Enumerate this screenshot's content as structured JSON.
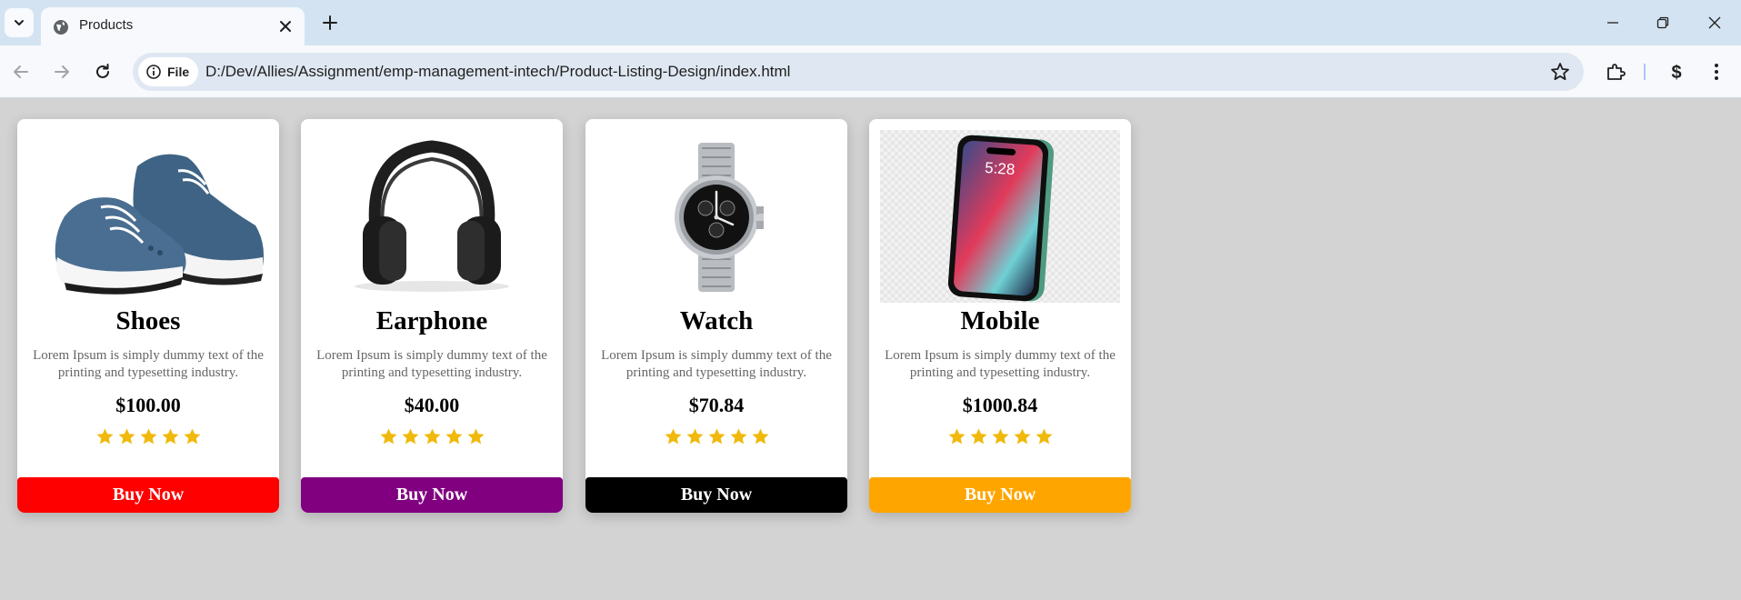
{
  "browser": {
    "tab_title": "Products",
    "file_chip_label": "File",
    "url": "D:/Dev/Allies/Assignment/emp-management-intech/Product-Listing-Design/index.html"
  },
  "products": [
    {
      "name": "Shoes",
      "description": "Lorem Ipsum is simply dummy text of the printing and typesetting industry.",
      "price": "$100.00",
      "rating": 5,
      "button_label": "Buy Now",
      "button_color": "#ff0000",
      "image": "shoes-image"
    },
    {
      "name": "Earphone",
      "description": "Lorem Ipsum is simply dummy text of the printing and typesetting industry.",
      "price": "$40.00",
      "rating": 5,
      "button_label": "Buy Now",
      "button_color": "#800080",
      "image": "headphones-image"
    },
    {
      "name": "Watch",
      "description": "Lorem Ipsum is simply dummy text of the printing and typesetting industry.",
      "price": "$70.84",
      "rating": 5,
      "button_label": "Buy Now",
      "button_color": "#000000",
      "image": "watch-image"
    },
    {
      "name": "Mobile",
      "description": "Lorem Ipsum is simply dummy text of the printing and typesetting industry.",
      "price": "$1000.84",
      "rating": 5,
      "button_label": "Buy Now",
      "button_color": "#ffa500",
      "image": "phone-image"
    }
  ],
  "colors": {
    "page_background": "#d3d3d3",
    "star": "#f0b90b",
    "tabstrip": "#d3e3f1"
  }
}
